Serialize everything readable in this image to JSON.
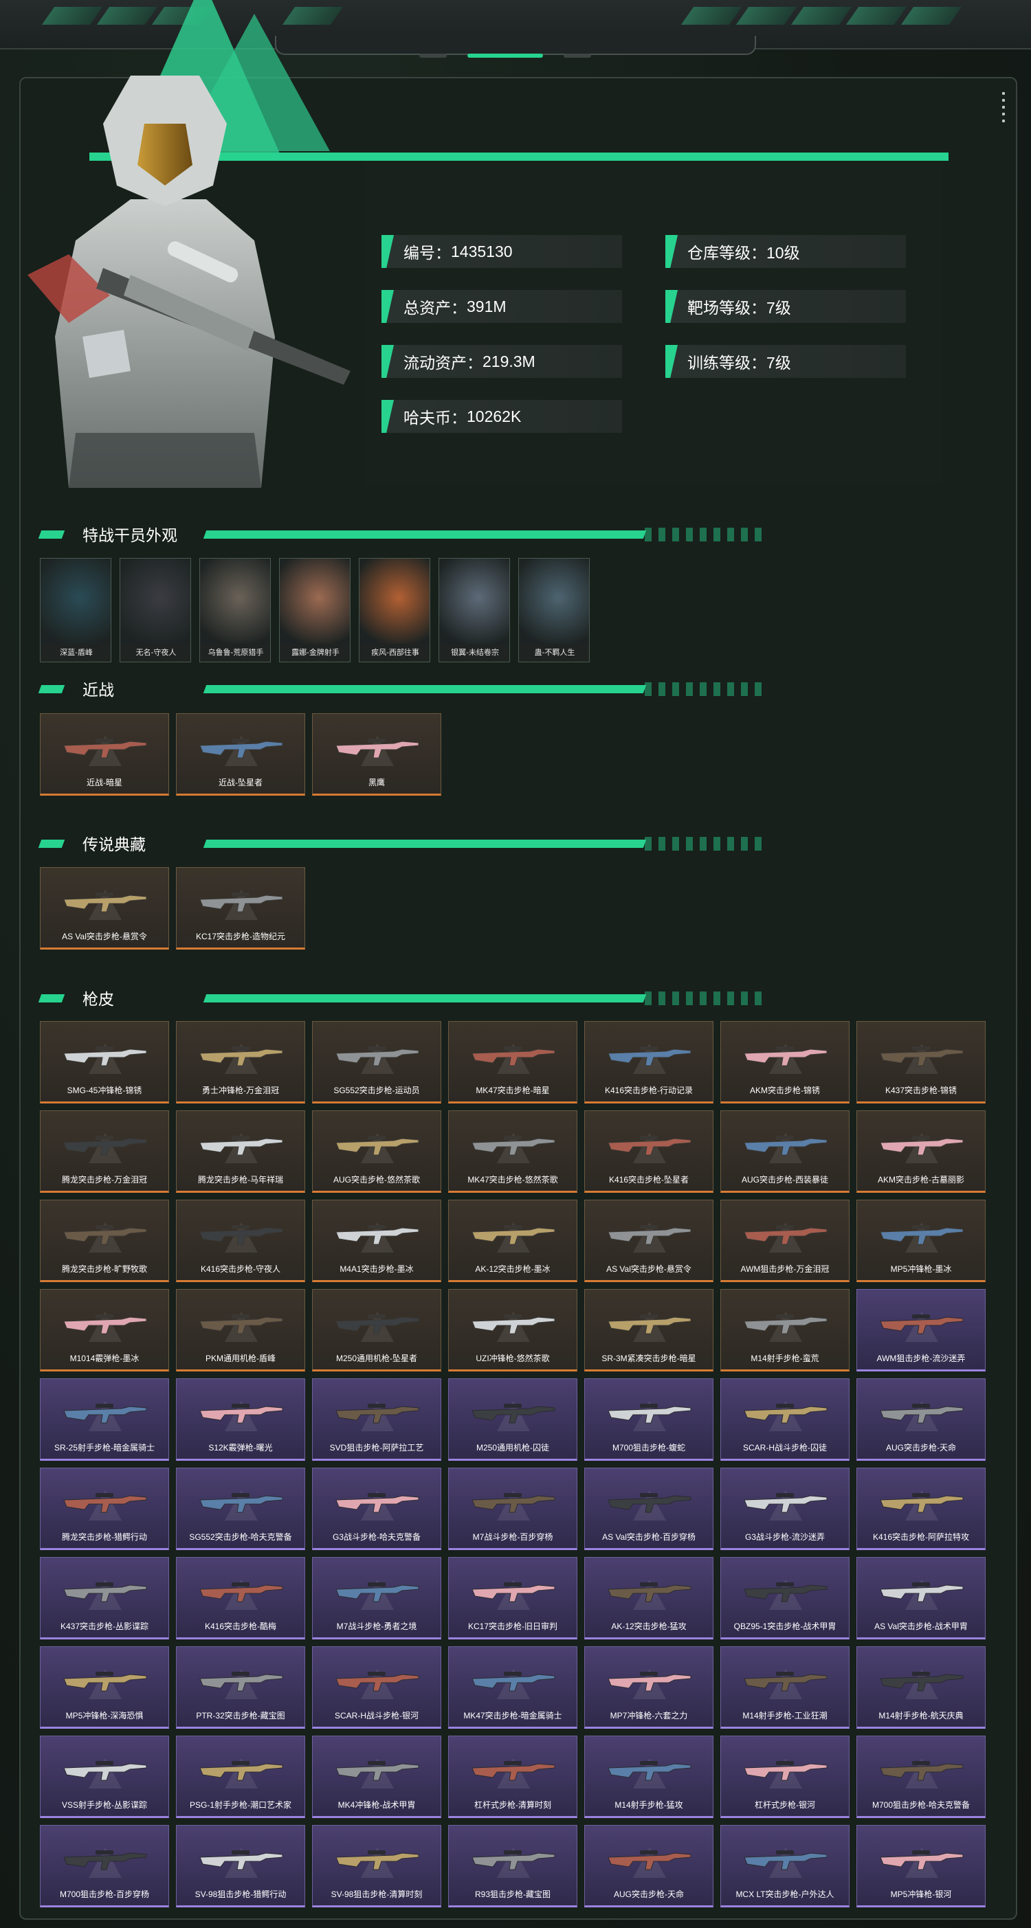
{
  "stats": [
    {
      "label": "编号：",
      "value": "1435130"
    },
    {
      "label": "总资产：",
      "value": "391M"
    },
    {
      "label": "流动资产：",
      "value": "219.3M"
    },
    {
      "label": "哈夫币：",
      "value": "10262K"
    },
    {
      "label": "仓库等级：",
      "value": "10级"
    },
    {
      "label": "靶场等级：",
      "value": "7级"
    },
    {
      "label": "训练等级：",
      "value": "7级"
    }
  ],
  "sections": {
    "operators": "特战干员外观",
    "melee": "近战",
    "legendary": "传说典藏",
    "skins": "枪皮"
  },
  "operators": [
    "深蓝-盾峰",
    "无名-守夜人",
    "乌鲁鲁-荒原猎手",
    "露娜-金牌射手",
    "疾风-西部往事",
    "银翼-未结卷宗",
    "蛊-不羁人生"
  ],
  "melee": [
    "近战-暗星",
    "近战-坠星者",
    "黑鹰"
  ],
  "legendary": [
    "AS Val突击步枪-悬赏令",
    "KC17突击步枪-造物纪元"
  ],
  "skins": [
    "SMG-45冲锋枪-锦锈",
    "勇士冲锋枪-万金泪冠",
    "SG552突击步枪-运动员",
    "MK47突击步枪-暗星",
    "K416突击步枪-行动记录",
    "AKM突击步枪-锦锈",
    "K437突击步枪-锦锈",
    "腾龙突击步枪-万金泪冠",
    "腾龙突击步枪-马年祥瑞",
    "AUG突击步枪-悠然茶歌",
    "MK47突击步枪-悠然茶歌",
    "K416突击步枪-坠星者",
    "AUG突击步枪-西装暴徒",
    "AKM突击步枪-古墓丽影",
    "腾龙突击步枪-旷野牧歌",
    "K416突击步枪-守夜人",
    "M4A1突击步枪-墨冰",
    "AK-12突击步枪-墨冰",
    "AS Val突击步枪-悬赏令",
    "AWM狙击步枪-万金泪冠",
    "MP5冲锋枪-墨冰",
    "M1014霰弹枪-墨冰",
    "PKM通用机枪-盾峰",
    "M250通用机枪-坠星者",
    "UZI冲锋枪-悠然茶歌",
    "SR-3M紧凑突击步枪-暗星",
    "M14射手步枪-蛮荒",
    "AWM狙击步枪-流沙迷弄",
    "SR-25射手步枪-暗金属骑士",
    "S12K霰弹枪-曙光",
    "SVD狙击步枪-阿萨拉工艺",
    "M250通用机枪-囚徒",
    "M700狙击步枪-蝮蛇",
    "SCAR-H战斗步枪-囚徒",
    "AUG突击步枪-天命",
    "腾龙突击步枪-猎鳄行动",
    "SG552突击步枪-哈夫克警备",
    "G3战斗步枪-哈夫克警备",
    "M7战斗步枪-百步穿杨",
    "AS Val突击步枪-百步穿杨",
    "G3战斗步枪-流沙迷弄",
    "K416突击步枪-阿萨拉特攻",
    "K437突击步枪-丛影谍踪",
    "K416突击步枪-酷梅",
    "M7战斗步枪-勇者之境",
    "KC17突击步枪-旧日审判",
    "AK-12突击步枪-猛攻",
    "QBZ95-1突击步枪-战术甲胄",
    "AS Val突击步枪-战术甲胄",
    "MP5冲锋枪-深海恐惧",
    "PTR-32突击步枪-藏宝图",
    "SCAR-H战斗步枪-银河",
    "MK47突击步枪-暗金属骑士",
    "MP7冲锋枪-六套之力",
    "M14射手步枪-工业狂潮",
    "M14射手步枪-航天庆典",
    "VSS射手步枪-丛影谍踪",
    "PSG-1射手步枪-潮口艺术家",
    "MK4冲锋枪-战术甲胄",
    "杠杆式步枪-清算时刻",
    "M14射手步枪-猛攻",
    "杠杆式步枪-银河",
    "M700狙击步枪-哈夫克警备",
    "M700狙击步枪-百步穿杨",
    "SV-98狙击步枪-猎鳄行动",
    "SV-98狙击步枪-清算时刻",
    "R93狙击步枪-藏宝图",
    "AUG突击步枪-天命",
    "MCX LT突击步枪-户外达人",
    "MP5冲锋枪-银河"
  ],
  "colors": {
    "accent": "#27d38f",
    "gold_border": "#d77b33",
    "purple_border": "#9b83e0"
  }
}
